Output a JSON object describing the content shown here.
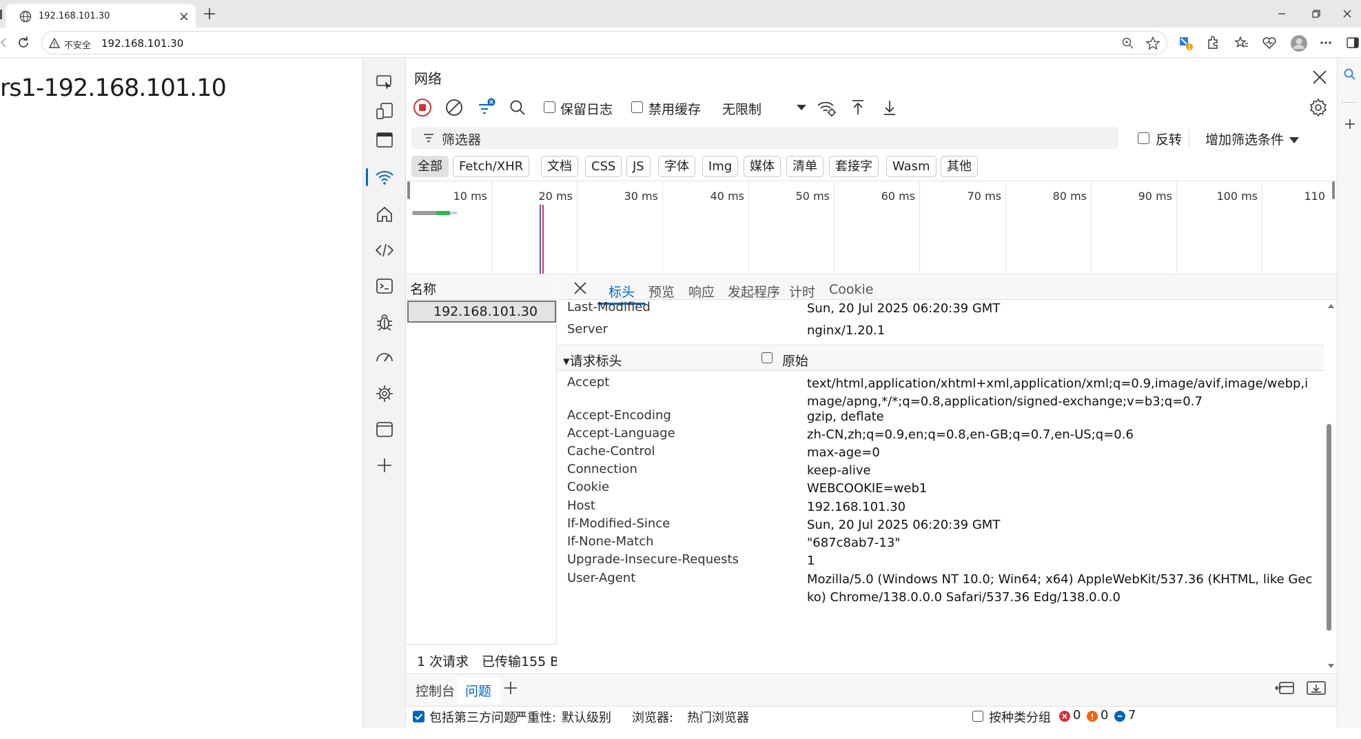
{
  "browser": {
    "tab_title": "192.168.101.30",
    "security_label": "不安全",
    "url": "192.168.101.30"
  },
  "page": {
    "heading": "rs1-192.168.101.10"
  },
  "devtools": {
    "panel_title": "网络",
    "toolbar": {
      "preserve_log": "保留日志",
      "disable_cache": "禁用缓存",
      "throttling": "无限制"
    },
    "filter": {
      "placeholder": "筛选器",
      "invert": "反转",
      "more_filters": "增加筛选条件"
    },
    "type_filters": [
      "全部",
      "Fetch/XHR",
      "文档",
      "CSS",
      "JS",
      "字体",
      "Img",
      "媒体",
      "清单",
      "套接字",
      "Wasm",
      "其他"
    ],
    "timeline_ticks": [
      "10 ms",
      "20 ms",
      "30 ms",
      "40 ms",
      "50 ms",
      "60 ms",
      "70 ms",
      "80 ms",
      "90 ms",
      "100 ms",
      "110"
    ],
    "request_list": {
      "column_name": "名称",
      "rows": [
        "192.168.101.30"
      ],
      "status_requests": "1 次请求",
      "status_transferred": "已传输155 B"
    },
    "detail_tabs": [
      "标头",
      "预览",
      "响应",
      "发起程序",
      "计时",
      "Cookie"
    ],
    "response_headers_tail": [
      {
        "name": "Last-Modified",
        "value": "Sun, 20 Jul 2025 06:20:39 GMT"
      },
      {
        "name": "Server",
        "value": "nginx/1.20.1"
      }
    ],
    "request_headers_section": "▾请求标头",
    "raw_label": "原始",
    "request_headers": [
      {
        "name": "Accept",
        "value": "text/html,application/xhtml+xml,application/xml;q=0.9,image/avif,image/webp,image/apng,*/*;q=0.8,application/signed-exchange;v=b3;q=0.7"
      },
      {
        "name": "Accept-Encoding",
        "value": "gzip, deflate"
      },
      {
        "name": "Accept-Language",
        "value": "zh-CN,zh;q=0.9,en;q=0.8,en-GB;q=0.7,en-US;q=0.6"
      },
      {
        "name": "Cache-Control",
        "value": "max-age=0"
      },
      {
        "name": "Connection",
        "value": "keep-alive"
      },
      {
        "name": "Cookie",
        "value": "WEBCOOKIE=web1"
      },
      {
        "name": "Host",
        "value": "192.168.101.30"
      },
      {
        "name": "If-Modified-Since",
        "value": "Sun, 20 Jul 2025 06:20:39 GMT"
      },
      {
        "name": "If-None-Match",
        "value": "\"687c8ab7-13\""
      },
      {
        "name": "Upgrade-Insecure-Requests",
        "value": "1"
      },
      {
        "name": "User-Agent",
        "value": "Mozilla/5.0 (Windows NT 10.0; Win64; x64) AppleWebKit/537.36 (KHTML, like Gecko) Chrome/138.0.0.0 Safari/537.36 Edg/138.0.0.0"
      }
    ],
    "drawer": {
      "tabs": [
        "控制台",
        "问题"
      ],
      "include_third_party": "包括第三方问题",
      "severity_label": "严重性:",
      "severity_value": "默认级别",
      "browser_label": "浏览器:",
      "browser_value": "热门浏览器",
      "group_by_kind": "按种类分组",
      "errors": "0",
      "warnings": "0",
      "info": "7"
    },
    "colors": {
      "accent": "#0067c0",
      "record_red": "#d13438"
    }
  }
}
